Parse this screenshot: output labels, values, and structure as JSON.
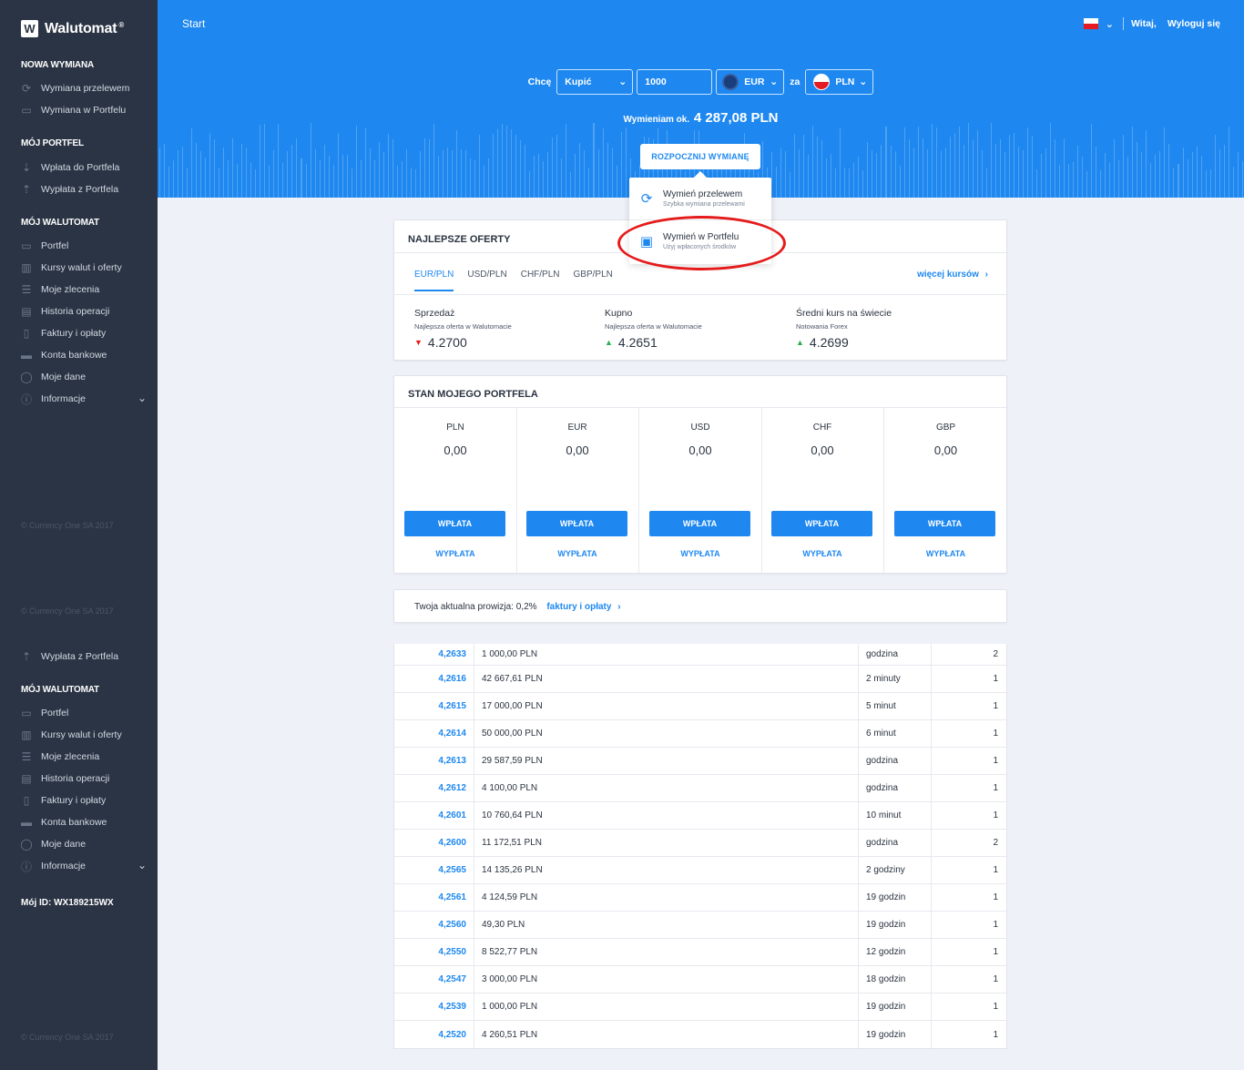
{
  "brand": {
    "name": "Walutomat",
    "reg": "®"
  },
  "sidebar": {
    "section1": {
      "title": "NOWA WYMIANA",
      "items": [
        {
          "label": "Wymiana przelewem",
          "icon": "refresh-icon"
        },
        {
          "label": "Wymiana w Portfelu",
          "icon": "wallet-exchange-icon"
        }
      ]
    },
    "section2": {
      "title": "MÓJ PORTFEL",
      "items": [
        {
          "label": "Wpłata do Portfela",
          "icon": "deposit-icon"
        },
        {
          "label": "Wypłata z Portfela",
          "icon": "withdraw-icon"
        }
      ]
    },
    "section3": {
      "title": "MÓJ WALUTOMAT",
      "items": [
        {
          "label": "Portfel",
          "icon": "wallet-icon"
        },
        {
          "label": "Kursy walut i oferty",
          "icon": "chart-icon"
        },
        {
          "label": "Moje zlecenia",
          "icon": "list-icon"
        },
        {
          "label": "Historia operacji",
          "icon": "history-icon"
        },
        {
          "label": "Faktury i opłaty",
          "icon": "invoice-icon"
        },
        {
          "label": "Konta bankowe",
          "icon": "bank-icon"
        },
        {
          "label": "Moje dane",
          "icon": "user-icon"
        },
        {
          "label": "Informacje",
          "icon": "info-icon"
        }
      ]
    },
    "copyright": "© Currency One SA 2017",
    "repeat": {
      "withdraw_label": "Wypłata z Portfela",
      "section_title": "MÓJ WALUTOMAT",
      "items": [
        "Portfel",
        "Kursy walut i oferty",
        "Moje zlecenia",
        "Historia operacji",
        "Faktury i opłaty",
        "Konta bankowe",
        "Moje dane",
        "Informacje"
      ]
    },
    "my_id": "Mój ID: WX189215WX"
  },
  "header": {
    "breadcrumb": "Start",
    "greeting": "Witaj,",
    "logout": "Wyloguj się",
    "form": {
      "want_label": "Chcę",
      "action_value": "Kupić",
      "amount_value": "1000",
      "currency_from": "EUR",
      "for_label": "za",
      "currency_to": "PLN"
    },
    "estimate_label": "Wymieniam ok.",
    "estimate_value": "4 287,08 PLN",
    "start_button": "ROZPOCZNIJ WYMIANĘ"
  },
  "dropdown": {
    "item1": {
      "title": "Wymień przelewem",
      "subtitle": "Szybka wymiana przelewami"
    },
    "item2": {
      "title": "Wymień w Portfelu",
      "subtitle": "Użyj wpłaconych środków"
    }
  },
  "offers": {
    "title": "NAJLEPSZE OFERTY",
    "tabs": [
      "EUR/PLN",
      "USD/PLN",
      "CHF/PLN",
      "GBP/PLN"
    ],
    "more_link": "więcej kursów",
    "columns": [
      {
        "heading": "Sprzedaż",
        "sub": "Najlepsza oferta w Walutomacie",
        "value": "4.2700",
        "trend": "down"
      },
      {
        "heading": "Kupno",
        "sub": "Najlepsza oferta w Walutomacie",
        "value": "4.2651",
        "trend": "up"
      },
      {
        "heading": "Średni kurs na świecie",
        "sub": "Notowania Forex",
        "value": "4.2699",
        "trend": "up"
      }
    ]
  },
  "portfolio": {
    "title": "STAN MOJEGO PORTFELA",
    "columns": [
      {
        "currency": "PLN",
        "amount": "0,00",
        "button": "WPŁATA",
        "link": "WYPŁATA"
      },
      {
        "currency": "EUR",
        "amount": "0,00",
        "button": "WPŁATA",
        "link": "WYPŁATA"
      },
      {
        "currency": "USD",
        "amount": "0,00",
        "button": "WPŁATA",
        "link": "WYPŁATA"
      },
      {
        "currency": "CHF",
        "amount": "0,00",
        "button": "WPŁATA",
        "link": "WYPŁATA"
      },
      {
        "currency": "GBP",
        "amount": "0,00",
        "button": "WPŁATA",
        "link": "WYPŁATA"
      }
    ]
  },
  "fee": {
    "text": "Twoja aktualna prowizja: 0,2%",
    "link": "faktury i opłaty"
  },
  "orders": [
    {
      "rate": "4,2633",
      "amount": "1 000,00 PLN",
      "time": "godzina",
      "count": "2"
    },
    {
      "rate": "4,2616",
      "amount": "42 667,61 PLN",
      "time": "2 minuty",
      "count": "1"
    },
    {
      "rate": "4,2615",
      "amount": "17 000,00 PLN",
      "time": "5 minut",
      "count": "1"
    },
    {
      "rate": "4,2614",
      "amount": "50 000,00 PLN",
      "time": "6 minut",
      "count": "1"
    },
    {
      "rate": "4,2613",
      "amount": "29 587,59 PLN",
      "time": "godzina",
      "count": "1"
    },
    {
      "rate": "4,2612",
      "amount": "4 100,00 PLN",
      "time": "godzina",
      "count": "1"
    },
    {
      "rate": "4,2601",
      "amount": "10 760,64 PLN",
      "time": "10 minut",
      "count": "1"
    },
    {
      "rate": "4,2600",
      "amount": "11 172,51 PLN",
      "time": "godzina",
      "count": "2"
    },
    {
      "rate": "4,2565",
      "amount": "14 135,26 PLN",
      "time": "2 godziny",
      "count": "1"
    },
    {
      "rate": "4,2561",
      "amount": "4 124,59 PLN",
      "time": "19 godzin",
      "count": "1"
    },
    {
      "rate": "4,2560",
      "amount": "49,30 PLN",
      "time": "19 godzin",
      "count": "1"
    },
    {
      "rate": "4,2550",
      "amount": "8 522,77 PLN",
      "time": "12 godzin",
      "count": "1"
    },
    {
      "rate": "4,2547",
      "amount": "3 000,00 PLN",
      "time": "18 godzin",
      "count": "1"
    },
    {
      "rate": "4,2539",
      "amount": "1 000,00 PLN",
      "time": "19 godzin",
      "count": "1"
    },
    {
      "rate": "4,2520",
      "amount": "4 260,51 PLN",
      "time": "19 godzin",
      "count": "1"
    }
  ],
  "colors": {
    "accent": "#1e88f0",
    "sidebar": "#2b3444",
    "highlight": "#e51a1a"
  }
}
